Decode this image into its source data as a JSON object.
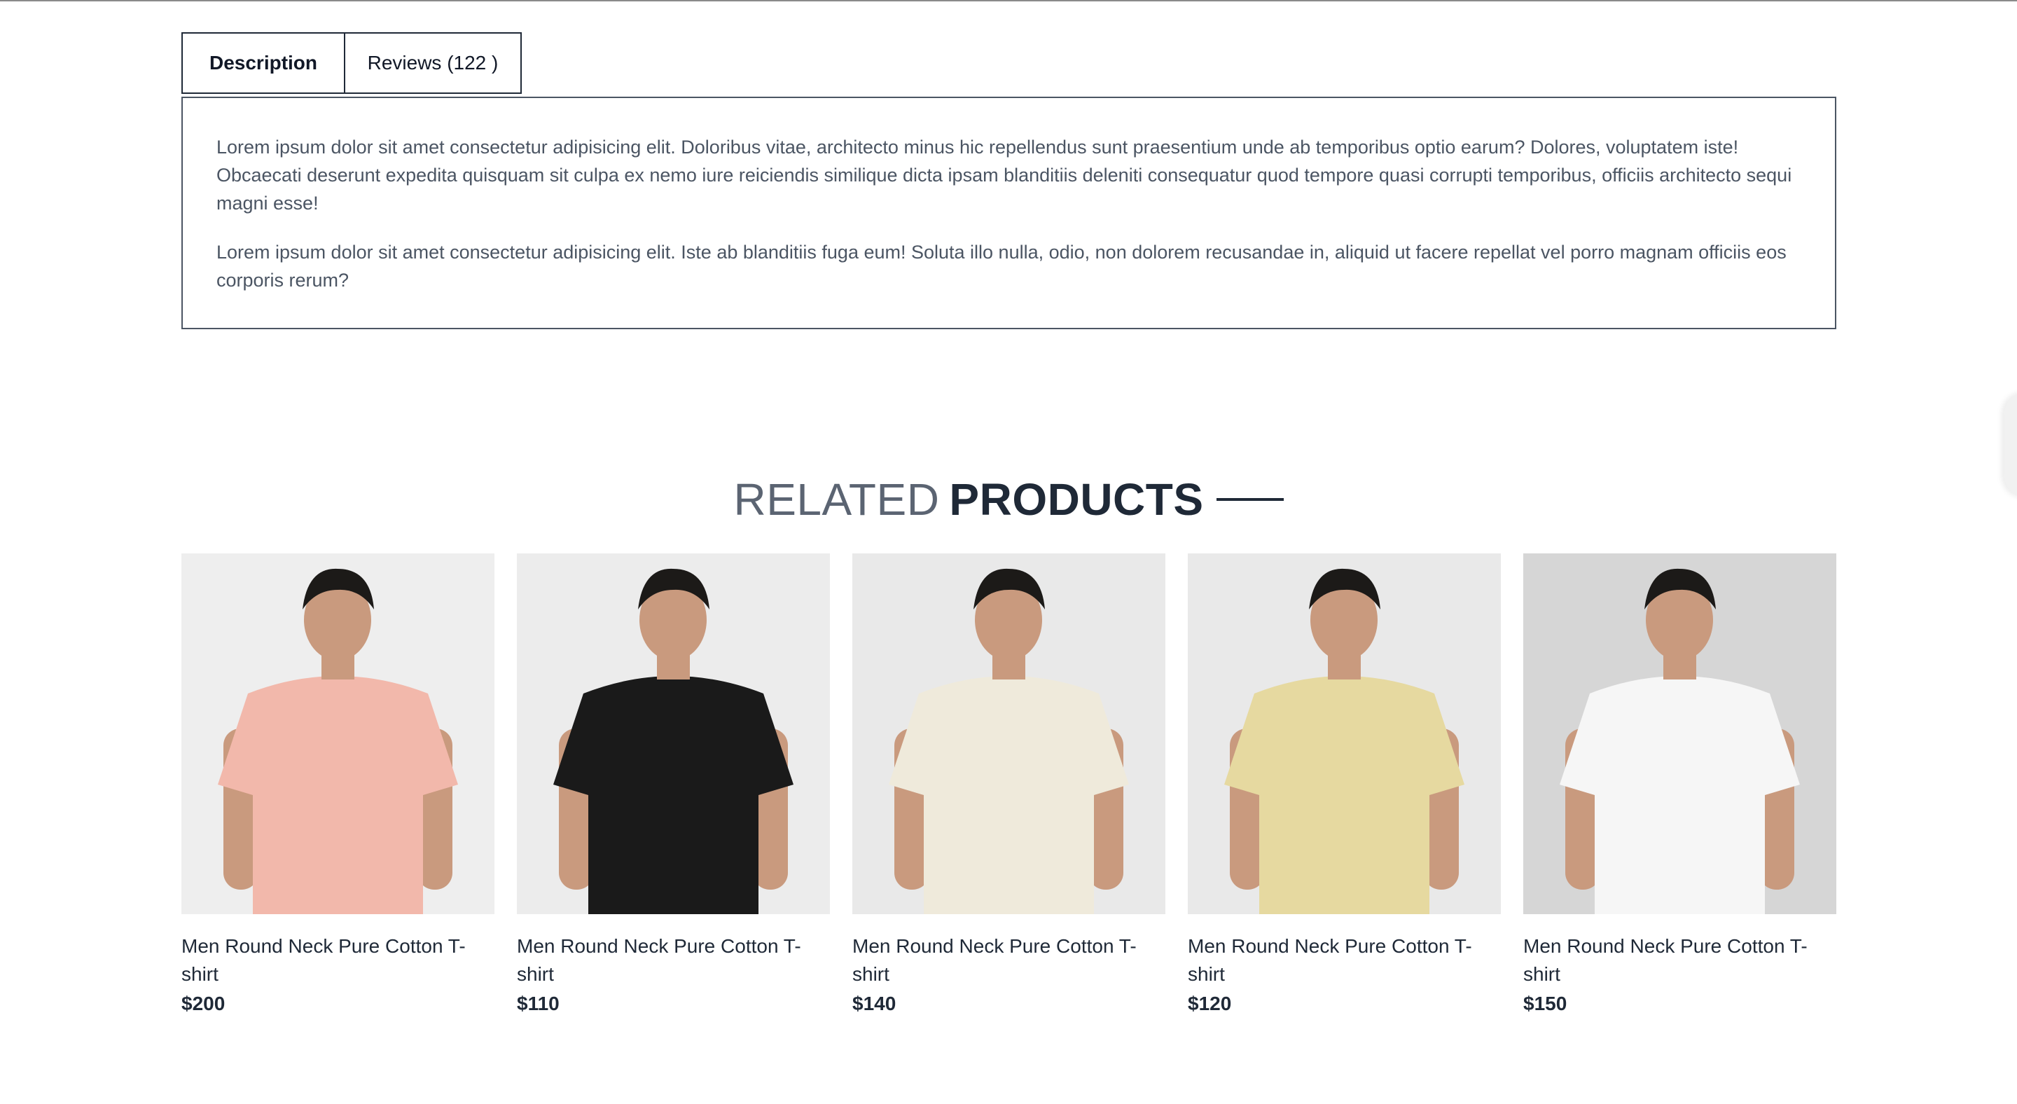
{
  "tabs": [
    {
      "label": "Description",
      "active": true
    },
    {
      "label": "Reviews (122 )",
      "active": false
    }
  ],
  "description": {
    "paragraphs": [
      "Lorem ipsum dolor sit amet consectetur adipisicing elit. Doloribus vitae, architecto minus hic repellendus sunt praesentium unde ab temporibus optio earum? Dolores, voluptatem iste! Obcaecati deserunt expedita quisquam sit culpa ex nemo iure reiciendis similique dicta ipsam blanditiis deleniti consequatur quod tempore quasi corrupti temporibus, officiis architecto sequi magni esse!",
      "Lorem ipsum dolor sit amet consectetur adipisicing elit. Iste ab blanditiis fuga eum! Soluta illo nulla, odio, non dolorem recusandae in, aliquid ut facere repellat vel porro magnam officiis eos corporis rerum?"
    ]
  },
  "related": {
    "heading_light": "RELATED",
    "heading_bold": "PRODUCTS"
  },
  "products": [
    {
      "name": "Men Round Neck Pure Cotton T-shirt",
      "price": "$200",
      "shirt_color": "#f2b8ab",
      "bg": "#eeeeee"
    },
    {
      "name": "Men Round Neck Pure Cotton T-shirt",
      "price": "$110",
      "shirt_color": "#1a1a1a",
      "bg": "#ececec"
    },
    {
      "name": "Men Round Neck Pure Cotton T-shirt",
      "price": "$140",
      "shirt_color": "#efeadb",
      "bg": "#e9e9e9"
    },
    {
      "name": "Men Round Neck Pure Cotton T-shirt",
      "price": "$120",
      "shirt_color": "#e6d9a0",
      "bg": "#e9e9e9"
    },
    {
      "name": "Men Round Neck Pure Cotton T-shirt",
      "price": "$150",
      "shirt_color": "#f6f6f6",
      "bg": "#d6d6d6"
    }
  ]
}
